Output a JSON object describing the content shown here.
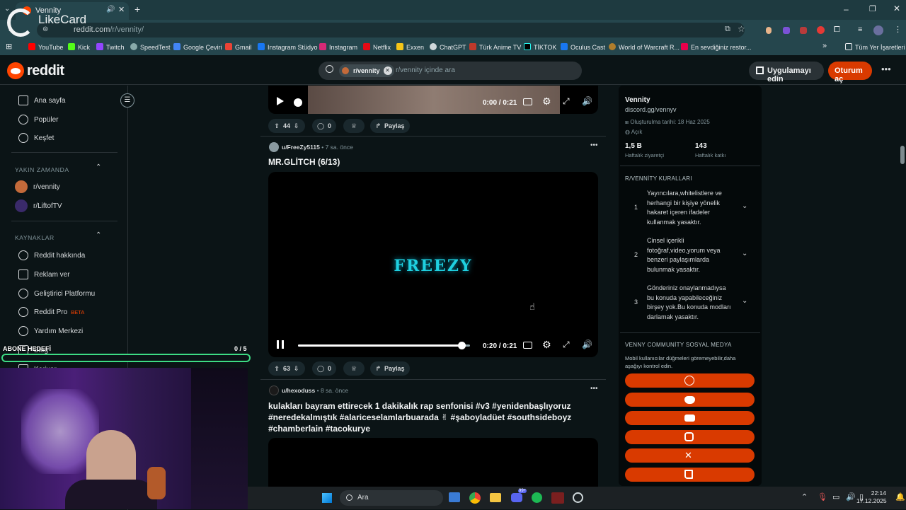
{
  "browser": {
    "tab_title": "Vennity",
    "url_host": "reddit.com",
    "url_path": "/r/vennity/",
    "overlay_logo": "LikeCard",
    "bookmarks": [
      "YouTube",
      "Kick",
      "Twitch",
      "SpeedTest",
      "Google Çeviri",
      "Gmail",
      "Instagram Stüdyo",
      "Instagram",
      "Netflix",
      "Exxen",
      "ChatGPT",
      "Türk Anime TV",
      "TİKTOK",
      "Oculus Cast",
      "World of Warcraft R...",
      "En sevdiğiniz restor..."
    ],
    "all_bookmarks": "Tüm Yer İşaretleri"
  },
  "reddit": {
    "logo_text": "reddit",
    "search_chip": "r/vennity",
    "search_placeholder": "r/vennity içinde ara",
    "get_app": "Uygulamayı edin",
    "login": "Oturum aç"
  },
  "nav": {
    "items": [
      "Ana sayfa",
      "Popüler",
      "Keşfet"
    ],
    "recent_header": "YAKIN ZAMANDA",
    "recent": [
      "r/vennity",
      "r/LiftofTV"
    ],
    "resources_header": "KAYNAKLAR",
    "resources": [
      "Reddit hakkında",
      "Reklam ver",
      "Geliştirici Platformu",
      "Reddit Pro",
      "Yardım Merkezi"
    ],
    "pro_badge": "BETA",
    "partial": [
      "Blog",
      "Kariyer"
    ]
  },
  "posts": [
    {
      "time": "0:00 / 0:21",
      "votes": "44",
      "comments": "0",
      "share": "Paylaş"
    },
    {
      "author": "u/FreeZy5115",
      "age": "7 sa. önce",
      "title": "MR.GLİTCH (6/13)",
      "video_text": "FREEZY",
      "time": "0:20 / 0:21",
      "progress": 0.95,
      "votes": "63",
      "comments": "0",
      "share": "Paylaş"
    },
    {
      "author": "u/hexoduss",
      "age": "8 sa. önce",
      "title_lines": [
        "kulakları bayram ettirecek 1 dakikalık rap senfonisi #v3 #yenidenbaşlıyoruz",
        "#neredekalmıştık #alariceselamlarbuarada ✌ #şaboyladüet #southsideboyz",
        "#chamberlain #tacokurye"
      ]
    }
  ],
  "sidebar": {
    "name": "Vennity",
    "link": "discord.gg/vennyv",
    "created": "Oluşturulma tarihi: 18 Haz 2025",
    "status": "Açık",
    "visitors_value": "1,5 B",
    "visitors_label": "Haftalık ziyaretçi",
    "contrib_value": "143",
    "contrib_label": "Haftalık katkı",
    "rules_header": "R/VENNİTY KURALLARI",
    "rules": [
      {
        "n": "1",
        "lines": [
          "Yayıncılara,whitelistlere ve",
          "herhangi bir kişiye yönelik",
          "hakaret içeren ifadeler",
          "kullanmak yasaktır."
        ]
      },
      {
        "n": "2",
        "lines": [
          "Cinsel içerikli",
          "fotoğraf,video,yorum veya",
          "benzeri paylaşımlarda",
          "bulunmak yasaktır."
        ]
      },
      {
        "n": "3",
        "lines": [
          "Gönderiniz onaylanmadıysa",
          "bu konuda yapabileceğiniz",
          "birşey yok.Bu konuda modları",
          "darlamak yasaktır."
        ]
      }
    ],
    "social_header": "VENNY COMMUNİTY SOSYAL MEDYA",
    "social_desc_lines": [
      "Mobil kullanıcılar düğmeleri göremeyebilir,daha",
      "aşağıyı kontrol edin."
    ],
    "social_icons": [
      "globe-icon",
      "discord-icon",
      "youtube-icon",
      "instagram-icon",
      "x-icon",
      "twitch-icon"
    ]
  },
  "overlay": {
    "goal_label": "ABONE HEDEFİ",
    "goal_count": "0 / 5",
    "goal_progress": 0.0
  },
  "taskbar": {
    "search": "Ara",
    "time": "22:14",
    "date": "17.12.2025",
    "badge": "99+"
  },
  "colors": {
    "reddit_orange": "#ff4500",
    "login_bg": "#d93a00",
    "goal_green": "#3ddc84",
    "freezy_cyan": "#1fd0e0"
  }
}
